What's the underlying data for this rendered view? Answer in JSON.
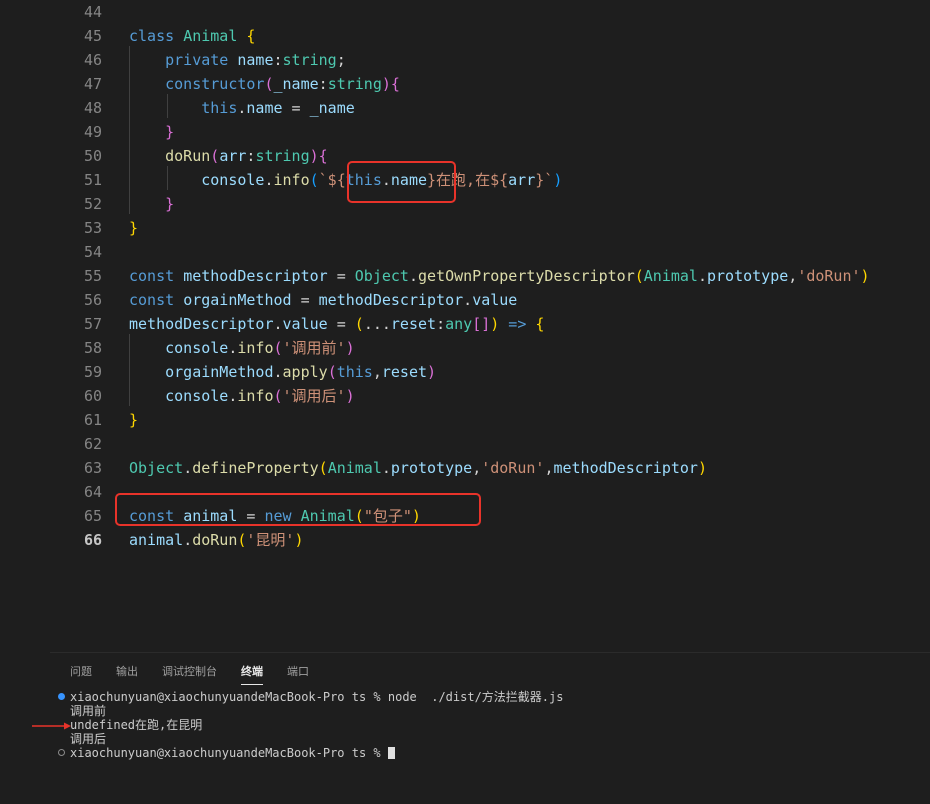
{
  "editor": {
    "lines": [
      {
        "n": "44",
        "tokens": []
      },
      {
        "n": "45",
        "tokens": [
          [
            "kw",
            "class "
          ],
          [
            "cls",
            "Animal"
          ],
          [
            "punc",
            " "
          ],
          [
            "br1",
            "{"
          ]
        ]
      },
      {
        "n": "46",
        "tokens": [
          [
            "punc",
            "    "
          ],
          [
            "kw",
            "private "
          ],
          [
            "prop",
            "name"
          ],
          [
            "punc",
            ":"
          ],
          [
            "cls",
            "string"
          ],
          [
            "punc",
            ";"
          ]
        ]
      },
      {
        "n": "47",
        "tokens": [
          [
            "punc",
            "    "
          ],
          [
            "kw",
            "constructor"
          ],
          [
            "br2",
            "("
          ],
          [
            "prop",
            "_name"
          ],
          [
            "punc",
            ":"
          ],
          [
            "cls",
            "string"
          ],
          [
            "br2",
            ")"
          ],
          [
            "br2",
            "{"
          ]
        ]
      },
      {
        "n": "48",
        "tokens": [
          [
            "punc",
            "        "
          ],
          [
            "kw",
            "this"
          ],
          [
            "punc",
            "."
          ],
          [
            "prop",
            "name"
          ],
          [
            "punc",
            " = "
          ],
          [
            "prop",
            "_name"
          ]
        ]
      },
      {
        "n": "49",
        "tokens": [
          [
            "punc",
            "    "
          ],
          [
            "br2",
            "}"
          ]
        ]
      },
      {
        "n": "50",
        "tokens": [
          [
            "punc",
            "    "
          ],
          [
            "fn",
            "doRun"
          ],
          [
            "br2",
            "("
          ],
          [
            "prop",
            "arr"
          ],
          [
            "punc",
            ":"
          ],
          [
            "cls",
            "string"
          ],
          [
            "br2",
            ")"
          ],
          [
            "br2",
            "{"
          ]
        ]
      },
      {
        "n": "51",
        "tokens": [
          [
            "punc",
            "        "
          ],
          [
            "prop",
            "console"
          ],
          [
            "punc",
            "."
          ],
          [
            "fn",
            "info"
          ],
          [
            "br3",
            "("
          ],
          [
            "str",
            "`${"
          ],
          [
            "kw",
            "this"
          ],
          [
            "punc",
            "."
          ],
          [
            "prop",
            "name"
          ],
          [
            "str",
            "}在跑,在${"
          ],
          [
            "prop",
            "arr"
          ],
          [
            "str",
            "}`"
          ],
          [
            "br3",
            ")"
          ]
        ]
      },
      {
        "n": "52",
        "tokens": [
          [
            "punc",
            "    "
          ],
          [
            "br2",
            "}"
          ]
        ]
      },
      {
        "n": "53",
        "tokens": [
          [
            "br1",
            "}"
          ]
        ]
      },
      {
        "n": "54",
        "tokens": []
      },
      {
        "n": "55",
        "tokens": [
          [
            "kw",
            "const "
          ],
          [
            "prop",
            "methodDescriptor"
          ],
          [
            "punc",
            " = "
          ],
          [
            "cls",
            "Object"
          ],
          [
            "punc",
            "."
          ],
          [
            "fn",
            "getOwnPropertyDescriptor"
          ],
          [
            "br1",
            "("
          ],
          [
            "cls",
            "Animal"
          ],
          [
            "punc",
            "."
          ],
          [
            "prop",
            "prototype"
          ],
          [
            "punc",
            ","
          ],
          [
            "str",
            "'doRun'"
          ],
          [
            "br1",
            ")"
          ]
        ]
      },
      {
        "n": "56",
        "tokens": [
          [
            "kw",
            "const "
          ],
          [
            "prop",
            "orgainMethod"
          ],
          [
            "punc",
            " = "
          ],
          [
            "prop",
            "methodDescriptor"
          ],
          [
            "punc",
            "."
          ],
          [
            "prop",
            "value"
          ]
        ]
      },
      {
        "n": "57",
        "tokens": [
          [
            "prop",
            "methodDescriptor"
          ],
          [
            "punc",
            "."
          ],
          [
            "prop",
            "value"
          ],
          [
            "punc",
            " = "
          ],
          [
            "br1",
            "("
          ],
          [
            "punc",
            "..."
          ],
          [
            "prop",
            "reset"
          ],
          [
            "punc",
            ":"
          ],
          [
            "cls",
            "any"
          ],
          [
            "br2",
            "[]"
          ],
          [
            "br1",
            ")"
          ],
          [
            "kw",
            " =>"
          ],
          [
            "punc",
            " "
          ],
          [
            "br1",
            "{"
          ]
        ]
      },
      {
        "n": "58",
        "tokens": [
          [
            "punc",
            "    "
          ],
          [
            "prop",
            "console"
          ],
          [
            "punc",
            "."
          ],
          [
            "fn",
            "info"
          ],
          [
            "br2",
            "("
          ],
          [
            "str",
            "'调用前'"
          ],
          [
            "br2",
            ")"
          ]
        ]
      },
      {
        "n": "59",
        "tokens": [
          [
            "punc",
            "    "
          ],
          [
            "prop",
            "orgainMethod"
          ],
          [
            "punc",
            "."
          ],
          [
            "fn",
            "apply"
          ],
          [
            "br2",
            "("
          ],
          [
            "kw",
            "this"
          ],
          [
            "punc",
            ","
          ],
          [
            "prop",
            "reset"
          ],
          [
            "br2",
            ")"
          ]
        ]
      },
      {
        "n": "60",
        "tokens": [
          [
            "punc",
            "    "
          ],
          [
            "prop",
            "console"
          ],
          [
            "punc",
            "."
          ],
          [
            "fn",
            "info"
          ],
          [
            "br2",
            "("
          ],
          [
            "str",
            "'调用后'"
          ],
          [
            "br2",
            ")"
          ]
        ]
      },
      {
        "n": "61",
        "tokens": [
          [
            "br1",
            "}"
          ]
        ]
      },
      {
        "n": "62",
        "tokens": []
      },
      {
        "n": "63",
        "tokens": [
          [
            "cls",
            "Object"
          ],
          [
            "punc",
            "."
          ],
          [
            "fn",
            "defineProperty"
          ],
          [
            "br1",
            "("
          ],
          [
            "cls",
            "Animal"
          ],
          [
            "punc",
            "."
          ],
          [
            "prop",
            "prototype"
          ],
          [
            "punc",
            ","
          ],
          [
            "str",
            "'doRun'"
          ],
          [
            "punc",
            ","
          ],
          [
            "prop",
            "methodDescriptor"
          ],
          [
            "br1",
            ")"
          ]
        ]
      },
      {
        "n": "64",
        "tokens": []
      },
      {
        "n": "65",
        "tokens": [
          [
            "kw",
            "const "
          ],
          [
            "prop",
            "animal"
          ],
          [
            "punc",
            " = "
          ],
          [
            "kw",
            "new "
          ],
          [
            "cls",
            "Animal"
          ],
          [
            "br1",
            "("
          ],
          [
            "str",
            "\"包子\""
          ],
          [
            "br1",
            ")"
          ]
        ]
      },
      {
        "n": "66",
        "tokens": [
          [
            "prop",
            "animal"
          ],
          [
            "punc",
            "."
          ],
          [
            "fn",
            "doRun"
          ],
          [
            "br1",
            "("
          ],
          [
            "str",
            "'昆明'"
          ],
          [
            "br1",
            ")"
          ]
        ]
      }
    ]
  },
  "panel": {
    "tabs": [
      "问题",
      "输出",
      "调试控制台",
      "终端",
      "端口"
    ],
    "active_tab": "终端"
  },
  "terminal": {
    "prompt_line": "xiaochunyuan@xiaochunyuandeMacBook-Pro ts % node  ./dist/方法拦截器.js",
    "output_lines": [
      "调用前",
      "undefined在跑,在昆明",
      "调用后"
    ],
    "last_prompt": "xiaochunyuan@xiaochunyuandeMacBook-Pro ts % "
  },
  "colors": {
    "annotation_red": "#e8332a",
    "keyword": "#569cd6",
    "type": "#4ec9b0",
    "variable": "#9cdcfe",
    "function": "#dcdcaa",
    "string": "#ce9178"
  }
}
